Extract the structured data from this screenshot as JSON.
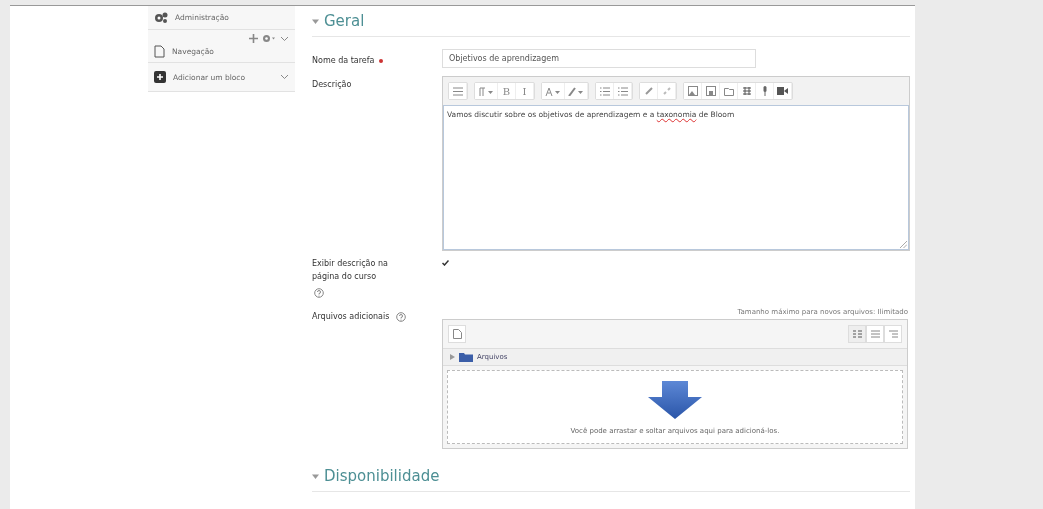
{
  "sidebar": {
    "blocks": [
      {
        "kind": "admin",
        "label": "Administração"
      },
      {
        "kind": "nav",
        "label": "Navegação"
      },
      {
        "kind": "add",
        "label": "Adicionar um bloco"
      }
    ]
  },
  "sections": [
    {
      "title": "Geral",
      "expanded": true
    },
    {
      "title": "Disponibilidade",
      "expanded": true
    }
  ],
  "task_name": {
    "label": "Nome da tarefa",
    "required": true,
    "value": "Objetivos de aprendizagem"
  },
  "description": {
    "label": "Descrição",
    "toolbar_letters": [
      "B",
      "I"
    ],
    "parts": [
      {
        "text": "Vamos discutir sobre os objetivos de aprendizagem e a ",
        "misspelled": false
      },
      {
        "text": "taxonomia",
        "misspelled": true
      },
      {
        "text": " de Bloom",
        "misspelled": false
      }
    ]
  },
  "show_description": {
    "label": "Exibir descrição na página do curso",
    "checked": true
  },
  "files": {
    "label": "Arquivos adicionais",
    "max_size": "Tamanho máximo para novos arquivos: Ilimitado",
    "folder": "Arquivos",
    "drop_hint": "Você pode arrastar e soltar arquivos aqui para adicioná-los."
  }
}
